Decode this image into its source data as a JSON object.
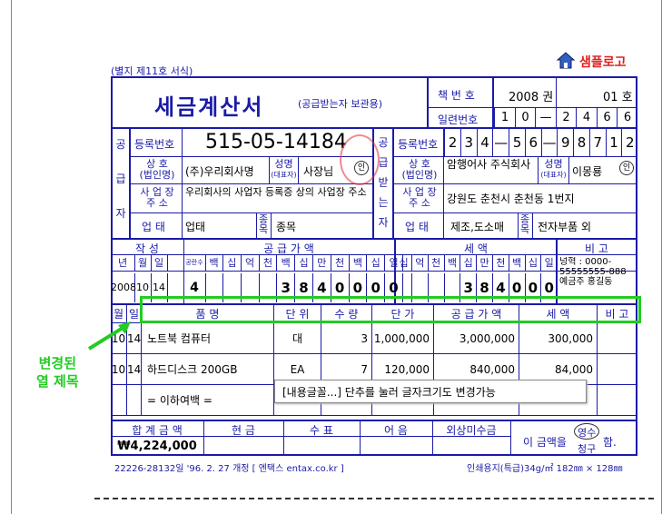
{
  "form_note": "(별지 제11호 서식)",
  "logo_text": "샘플로고",
  "title": "세금계산서",
  "subtitle": "(공급받는자 보관용)",
  "book_label": "책 번 호",
  "book_vol": "2008 권",
  "book_no": "01 호",
  "serial_label": "일련번호",
  "serial_digits": [
    "1",
    "0",
    "—",
    "2",
    "4",
    "6",
    "6"
  ],
  "supplier_side_label": [
    "공",
    "급",
    "자"
  ],
  "buyer_side_label": [
    "공",
    "급",
    "받",
    "는",
    "자"
  ],
  "reg_no_label": "등록번호",
  "supplier": {
    "reg_no": "515-05-14184",
    "company_label": "상 호\n(법인명)",
    "company": "(주)우리회사명",
    "name_label": "성명\n(대표자)",
    "name": "사장님",
    "addr_label": "사 업 장\n주 소",
    "address": "우리회사의 사업자 등록증 상의 사업장 주소",
    "biz_type_label": "업 태",
    "biz_type": "업태",
    "biz_item_label": "종목",
    "biz_item": "종목"
  },
  "buyer": {
    "reg_digits": [
      "2",
      "3",
      "4",
      "—",
      "5",
      "6",
      "—",
      "9",
      "8",
      "7",
      "1",
      "2"
    ],
    "company": "암행어사 주식회사",
    "name": "이몽룡",
    "address": "강원도 춘천시 춘천동 1번지",
    "biz_type": "제조,도소매",
    "biz_item": "전자부품 외"
  },
  "header": {
    "write": "작 성",
    "supply_amount": "공 급 가 액",
    "tax": "세 액",
    "remarks": "비 고",
    "ymd": [
      "년",
      "월",
      "일"
    ],
    "blank_count": "공란수",
    "supply_units": [
      "백",
      "십",
      "억",
      "천",
      "백",
      "십",
      "만",
      "천",
      "백",
      "십",
      "일"
    ],
    "tax_units": [
      "십",
      "억",
      "천",
      "백",
      "십",
      "만",
      "천",
      "백",
      "십",
      "일"
    ]
  },
  "write_row": {
    "year": "2008",
    "month": "10",
    "day": "14",
    "blanks": "4",
    "supply_digits": [
      "",
      "",
      "",
      "",
      "3",
      "8",
      "4",
      "0",
      "0",
      "0",
      "0"
    ],
    "tax_digits": [
      "",
      "",
      "",
      "",
      "3",
      "8",
      "4",
      "0",
      "0",
      "0"
    ],
    "remark": "넝혁 : 0000-55555555-888 예금주 홍길동"
  },
  "item_header": [
    "월",
    "일",
    "품 명",
    "단 위",
    "수 량",
    "단 가",
    "공 급 가 액",
    "세 액",
    "비 고"
  ],
  "items": [
    {
      "month": "10",
      "day": "14",
      "name": "노트북 컴퓨터",
      "unit": "대",
      "qty": "3",
      "price": "1,000,000",
      "supply": "3,000,000",
      "tax": "300,000"
    },
    {
      "month": "10",
      "day": "14",
      "name": "하드디스크 200GB",
      "unit": "EA",
      "qty": "7",
      "price": "120,000",
      "supply": "840,000",
      "tax": "84,000"
    },
    {
      "month": "",
      "day": "",
      "name": "= 이하여백 =",
      "unit": "",
      "qty": "",
      "price": "",
      "supply": "",
      "tax": ""
    }
  ],
  "tooltip": "[내용글꼴...] 단추를 눌러 글자크기도 변경가능",
  "annotation": "변경된\n열 제목",
  "totals": {
    "total_label": "합 계 금 액",
    "cash": "현 금",
    "check": "수 표",
    "note": "어 음",
    "credit": "외상미수금",
    "total": "₩4,224,000",
    "receipt_pre": "이 금액을",
    "receipt_stamp": "영수",
    "receipt_alt": "청구",
    "receipt_post": "함."
  },
  "footer_left": "22226-28132일 '96. 2. 27 개정  [ 엔택스 entax.co.kr ]",
  "footer_right": "인쇄용지(특급)34g/㎡ 182㎜ × 128㎜",
  "colors": {
    "form_blue": "#1a1aa8",
    "highlight_green": "#22cc22",
    "stamp_red": "#e03040"
  }
}
